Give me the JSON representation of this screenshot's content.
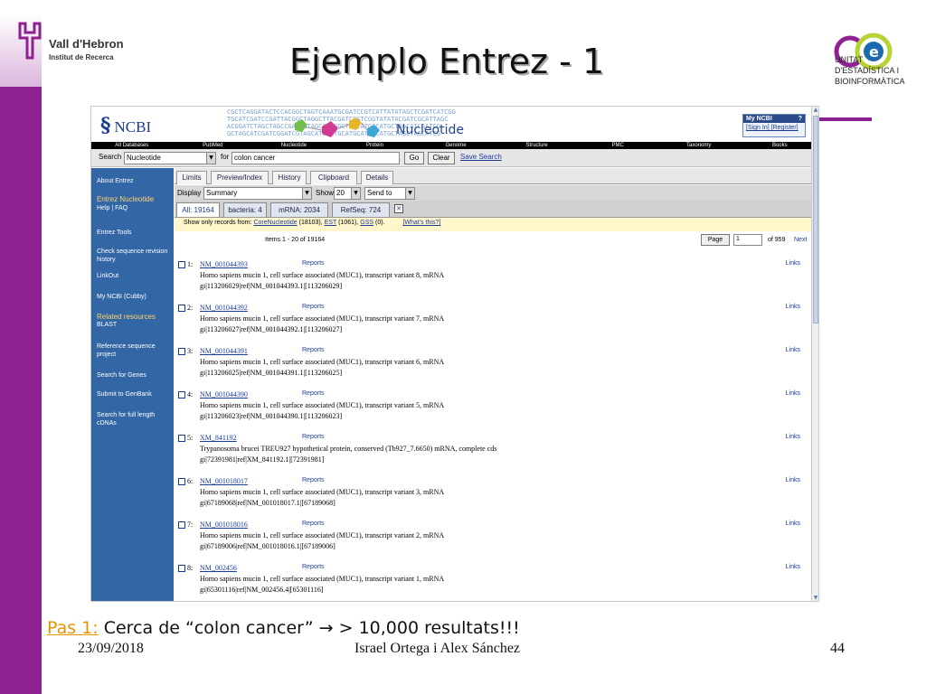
{
  "slide": {
    "title": "Ejemplo Entrez - 1",
    "caption_step": "Pas 1:",
    "caption_text": " Cerca de “colon cancer”  → > 10,000 resultats!!!",
    "date": "23/09/2018",
    "authors": "Israel Ortega i Alex Sánchez",
    "page": "44"
  },
  "logos": {
    "vall_hebron_line1": "Vall d'Hebron",
    "vall_hebron_line2": "Institut de Recerca",
    "ueb_line1": "UNITAT",
    "ueb_line2": "D'ESTADÍSTICA I",
    "ueb_line3": "BIOINFORMÀTICA"
  },
  "ncbi": {
    "logo": "NCBI",
    "section_title": "Nucleotide",
    "my_ncbi": {
      "title": "My NCBI",
      "help": "?",
      "links": "[Sign In] [Register]"
    },
    "db_bar": [
      "All Databases",
      "PubMed",
      "Nucleotide",
      "Protein",
      "Genome",
      "Structure",
      "PMC",
      "Taxonomy",
      "Books"
    ],
    "search": {
      "label": "Search",
      "db_selected": "Nucleotide",
      "for_label": "for",
      "query": "colon cancer",
      "go": "Go",
      "clear": "Clear",
      "save": "Save Search"
    },
    "tabs": [
      "Limits",
      "Preview/Index",
      "History",
      "Clipboard",
      "Details"
    ],
    "display": {
      "display_label": "Display",
      "display_value": "Summary",
      "show_label": "Show",
      "show_value": "20",
      "send_value": "Send to"
    },
    "result_tabs": [
      "All: 19164",
      "bacteria: 4",
      "mRNA: 2034",
      "RefSeq: 724"
    ],
    "show_only": {
      "prefix": "Show only records from:",
      "core": "CoreNucleotide",
      "core_count": "(18103),",
      "est": "EST",
      "est_count": "(1061),",
      "gss": "GSS",
      "gss_count": "(0).",
      "whats_this": "[What's this?]"
    },
    "items_text": "Items 1 - 20 of 19164",
    "pager": {
      "page_btn": "Page",
      "page_value": "1",
      "of_text": "of 959",
      "next": "Next"
    },
    "sidebar": [
      {
        "label": "About Entrez",
        "highlight": false
      },
      {
        "label": "Entrez Nucleotide",
        "highlight": true
      },
      {
        "label": "Help | FAQ",
        "highlight": false
      },
      {
        "label": "Entrez Tools",
        "highlight": false
      },
      {
        "label": "Check sequence revision history",
        "highlight": false
      },
      {
        "label": "LinkOut",
        "highlight": false
      },
      {
        "label": "My NCBI (Cubby)",
        "highlight": false
      },
      {
        "label": "Related resources",
        "highlight": true
      },
      {
        "label": "BLAST",
        "highlight": false
      },
      {
        "label": "Reference sequence project",
        "highlight": false
      },
      {
        "label": "Search for Genes",
        "highlight": false
      },
      {
        "label": "Submit to GenBank",
        "highlight": false
      },
      {
        "label": "Search for full length cDNAs",
        "highlight": false
      }
    ],
    "reports_label": "Reports",
    "links_label": "Links",
    "results": [
      {
        "num": "1:",
        "acc": "NM_001044393",
        "desc": "Homo sapiens mucin 1, cell surface associated (MUC1), transcript variant 8, mRNA",
        "gi": "gi|113206029|ref|NM_001044393.1|[113206029]"
      },
      {
        "num": "2:",
        "acc": "NM_001044392",
        "desc": "Homo sapiens mucin 1, cell surface associated (MUC1), transcript variant 7, mRNA",
        "gi": "gi|113206027|ref|NM_001044392.1|[113206027]"
      },
      {
        "num": "3:",
        "acc": "NM_001044391",
        "desc": "Homo sapiens mucin 1, cell surface associated (MUC1), transcript variant 6, mRNA",
        "gi": "gi|113206025|ref|NM_001044391.1|[113206025]"
      },
      {
        "num": "4:",
        "acc": "NM_001044390",
        "desc": "Homo sapiens mucin 1, cell surface associated (MUC1), transcript variant 5, mRNA",
        "gi": "gi|113206023|ref|NM_001044390.1|[113206023]"
      },
      {
        "num": "5:",
        "acc": "XM_841192",
        "desc": "Trypanosoma brucei TREU927 hypothetical protein, conserved (Tb927_7.6650) mRNA, complete cds",
        "gi": "gi|72391981|ref|XM_841192.1|[72391981]"
      },
      {
        "num": "6:",
        "acc": "NM_001018017",
        "desc": "Homo sapiens mucin 1, cell surface associated (MUC1), transcript variant 3, mRNA",
        "gi": "gi|67189068|ref|NM_001018017.1|[67189068]"
      },
      {
        "num": "7:",
        "acc": "NM_001018016",
        "desc": "Homo sapiens mucin 1, cell surface associated (MUC1), transcript variant 2, mRNA",
        "gi": "gi|67189006|ref|NM_001018016.1|[67189006]"
      },
      {
        "num": "8:",
        "acc": "NM_002456",
        "desc": "Homo sapiens mucin 1, cell surface associated (MUC1), transcript variant 1, mRNA",
        "gi": "gi|65301116|ref|NM_002456.4|[65301116]"
      }
    ]
  },
  "colors": {
    "purple": "#8e2192",
    "ncbi_blue": "#3366a4",
    "link_blue": "#1a3c9c",
    "step_orange": "#e69300"
  }
}
